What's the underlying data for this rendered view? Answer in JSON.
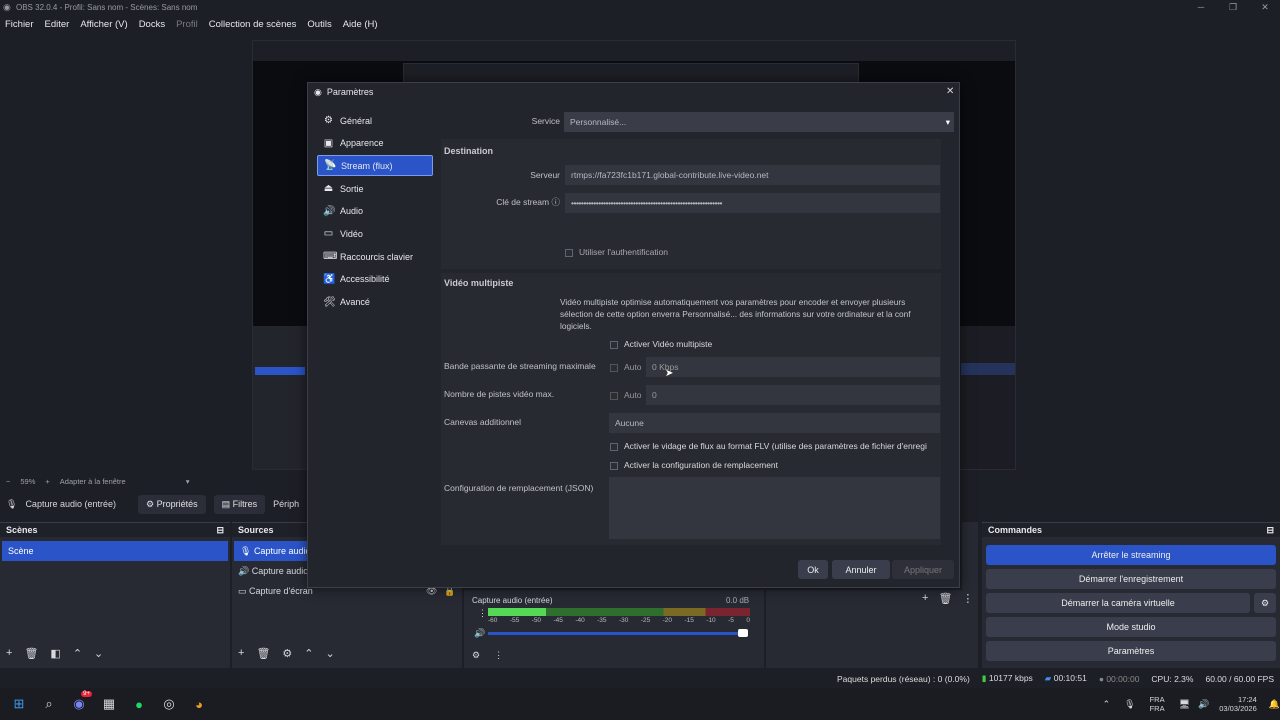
{
  "window": {
    "title": "OBS 32.0.4 - Profil: Sans nom - Scènes: Sans nom"
  },
  "menu": [
    {
      "label": "Fichier",
      "dim": false
    },
    {
      "label": "Editer",
      "dim": false
    },
    {
      "label": "Afficher (V)",
      "dim": false
    },
    {
      "label": "Docks",
      "dim": false
    },
    {
      "label": "Profil",
      "dim": true
    },
    {
      "label": "Collection de scènes",
      "dim": false
    },
    {
      "label": "Outils",
      "dim": false
    },
    {
      "label": "Aide (H)",
      "dim": false
    }
  ],
  "scale": {
    "zoom": "59%",
    "fit": "Adapter à la fenêtre"
  },
  "context": {
    "source": "Capture audio (entrée)",
    "properties": "Propriétés",
    "filters": "Filtres",
    "more": "Périph"
  },
  "scenes": {
    "title": "Scènes",
    "items": [
      "Scène"
    ]
  },
  "sources": {
    "title": "Sources",
    "items": [
      "Capture audio",
      "Capture audio",
      "Capture d'écran"
    ]
  },
  "mixer": {
    "source": "Capture audio (entrée)",
    "db": "0.0 dB",
    "ticks": [
      "-60",
      "-55",
      "-50",
      "-45",
      "-40",
      "-35",
      "-30",
      "-25",
      "-20",
      "-15",
      "-10",
      "-5",
      "0"
    ],
    "level": 0.22,
    "volume": 1.0
  },
  "commands": {
    "title": "Commandes",
    "buttons": [
      "Arrêter le streaming",
      "Démarrer l'enregistrement",
      "Démarrer la caméra virtuelle",
      "Mode studio",
      "Paramètres"
    ]
  },
  "status": {
    "dropped": "Paquets perdus (réseau) : 0 (0.0%)",
    "bitrate": "10177 kbps",
    "stream_time": "00:10:51",
    "rec_time": "00:00:00",
    "cpu": "CPU: 2.3%",
    "fps": "60.00 / 60.00 FPS"
  },
  "taskbar": {
    "lang1": "FRA",
    "lang2": "FRA",
    "time": "17:24",
    "date": "03/03/2026",
    "badge": "9+"
  },
  "settings": {
    "title": "Paramètres",
    "nav": [
      {
        "label": "Général",
        "icon": "gear-icon",
        "glyph": "⚙"
      },
      {
        "label": "Apparence",
        "icon": "appearance-icon",
        "glyph": "▣"
      },
      {
        "label": "Stream (flux)",
        "icon": "antenna-icon",
        "glyph": "📡"
      },
      {
        "label": "Sortie",
        "icon": "output-icon",
        "glyph": "⏏"
      },
      {
        "label": "Audio",
        "icon": "speaker-icon",
        "glyph": "🔊"
      },
      {
        "label": "Vidéo",
        "icon": "monitor-icon",
        "glyph": "▭"
      },
      {
        "label": "Raccourcis clavier",
        "icon": "keyboard-icon",
        "glyph": "⌨"
      },
      {
        "label": "Accessibilité",
        "icon": "accessibility-icon",
        "glyph": "♿"
      },
      {
        "label": "Avancé",
        "icon": "wrench-icon",
        "glyph": "🛠"
      }
    ],
    "service_label": "Service",
    "service_value": "Personnalisé...",
    "dest_title": "Destination",
    "server_label": "Serveur",
    "server_value": "rtmps://fa723fc1b171.global-contribute.live-video.net",
    "key_label": "Clé de stream",
    "key_value": "•••••••••••••••••••••••••••••••••••••••••••••••••••••••••••••",
    "auth_label": "Utiliser l'authentification",
    "multi_title": "Vidéo multipiste",
    "multi_desc": "Vidéo multipiste optimise automatiquement vos paramètres pour encoder et envoyer plusieurs sélection de cette option enverra Personnalisé... des informations sur votre ordinateur et la conf logiciels.",
    "multi_enable": "Activer Vidéo multipiste",
    "bw_label": "Bande passante de streaming maximale",
    "bw_auto": "Auto",
    "bw_value": "0 Kbps",
    "tracks_label": "Nombre de pistes vidéo max.",
    "tracks_auto": "Auto",
    "tracks_value": "0",
    "canvas_label": "Canevas additionnel",
    "canvas_value": "Aucune",
    "flv_label": "Activer le vidage de flux au format FLV (utilise des paramètres de fichier d'enregi",
    "replace_label": "Activer la configuration de remplacement",
    "json_label": "Configuration de remplacement (JSON)",
    "ok": "Ok",
    "cancel": "Annuler",
    "apply": "Appliquer"
  }
}
